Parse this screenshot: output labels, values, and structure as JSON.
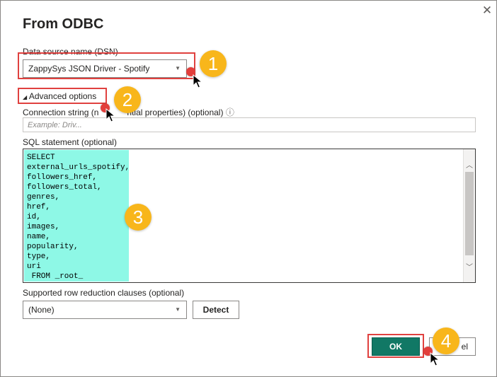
{
  "dialog": {
    "title": "From ODBC",
    "close_icon": "close-icon"
  },
  "dsn": {
    "label": "Data source name (DSN)",
    "value": "ZappySys JSON Driver - Spotify"
  },
  "advanced": {
    "label": "Advanced options",
    "expander_glyph": "◢"
  },
  "connection_string": {
    "label_a": "Connection string (n",
    "label_b": "ntial properties) (optional)",
    "info_glyph": "ⓘ",
    "placeholder": "Example: Driv..."
  },
  "sql": {
    "label": "SQL statement (optional)",
    "lines": [
      "SELECT",
      "external_urls_spotify,",
      "followers_href,",
      "followers_total,",
      "genres,",
      "href,",
      "id,",
      "images,",
      "name,",
      "popularity,",
      "type,",
      "uri",
      " FROM _root_"
    ]
  },
  "row_reduction": {
    "label": "Supported row reduction clauses (optional)",
    "value": "(None)",
    "detect_label": "Detect"
  },
  "footer": {
    "ok_label": "OK",
    "cancel_label_visible": "el"
  },
  "callouts": [
    "1",
    "2",
    "3",
    "4"
  ],
  "colors": {
    "accent_ok": "#117865",
    "highlight_box": "#e0413f",
    "callout": "#f8b61b",
    "sql_highlight": "#8ef8e6"
  }
}
